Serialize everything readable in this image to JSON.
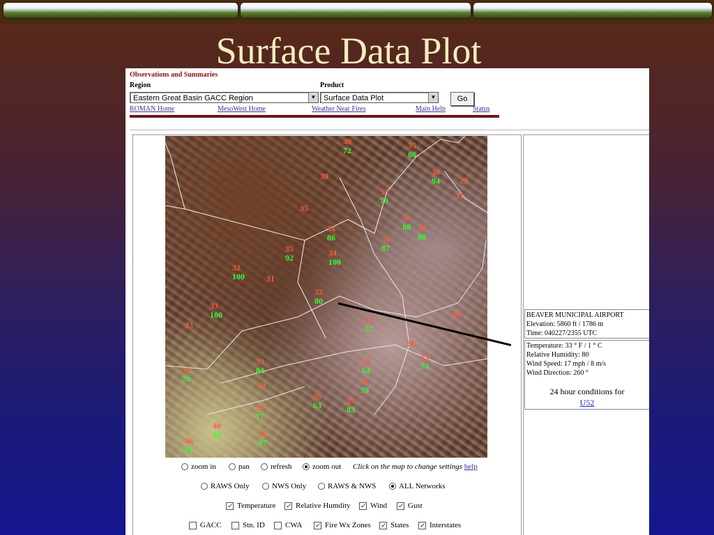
{
  "slide": {
    "title": "Surface Data Plot"
  },
  "header": {
    "title": "Observations and Summaries",
    "region_label": "Region",
    "product_label": "Product",
    "region_value": "Eastern Great Basin GACC Region",
    "product_value": "Surface Data Plot",
    "go_label": "Go"
  },
  "nav": {
    "links": [
      "ROMAN Home",
      "MesoWest Home",
      "Weather Near Fires",
      "Main Help",
      "Status"
    ]
  },
  "station": {
    "name": "BEAVER MUNICIPAL AIRPORT",
    "elevation": "Elevation: 5860 ft / 1786 m",
    "time": "Time: 040227/2355 UTC",
    "temperature": "Temperature: 33 ° F / 1 ° C",
    "humidity": "Relative Humidity: 80",
    "wind_speed": "Wind Speed: 17 mph / 8 m/s",
    "wind_direction": "Wind Direction: 260 °",
    "conditions_label": "24 hour conditions for",
    "conditions_link": "U52"
  },
  "map_observations": [
    {
      "t": "49",
      "h": "72"
    },
    {
      "t": "35",
      "h": "86"
    },
    {
      "t": "39",
      "h": ""
    },
    {
      "t": "38",
      "h": "94"
    },
    {
      "t": "29",
      "h": ""
    },
    {
      "t": "31",
      "h": ""
    },
    {
      "t": "35",
      "h": ""
    },
    {
      "t": "33",
      "h": "79"
    },
    {
      "t": "36",
      "h": "88"
    },
    {
      "t": "30",
      "h": "88"
    },
    {
      "t": "34",
      "h": "86"
    },
    {
      "t": "36",
      "h": "87"
    },
    {
      "t": "35",
      "h": "92"
    },
    {
      "t": "32",
      "h": "100"
    },
    {
      "t": "31",
      "h": ""
    },
    {
      "t": "34",
      "h": "100"
    },
    {
      "t": "33",
      "h": "100"
    },
    {
      "t": "32",
      "h": "80"
    },
    {
      "t": "33",
      "h": ""
    },
    {
      "t": "28",
      "h": ""
    },
    {
      "t": "31",
      "h": "57"
    },
    {
      "t": "28",
      "h": ""
    },
    {
      "t": "33",
      "h": "74"
    },
    {
      "t": "33",
      "h": "84"
    },
    {
      "t": "32",
      "h": "64"
    },
    {
      "t": "31",
      "h": "79"
    },
    {
      "t": "30",
      "h": ""
    },
    {
      "t": "37",
      "h": "77"
    },
    {
      "t": "40",
      "h": "50"
    },
    {
      "t": "37",
      "h": "97"
    },
    {
      "t": "46",
      "h": "91"
    },
    {
      "t": "31",
      "h": "74"
    },
    {
      "t": "29",
      "h": "83"
    },
    {
      "t": "26",
      "h": "63"
    }
  ],
  "controls": {
    "mode": [
      "zoom in",
      "pan",
      "refresh",
      "zoom out"
    ],
    "mode_selected": "zoom out",
    "hint": "Click on the map to change settings",
    "help": "help",
    "networks": [
      "RAWS Only",
      "NWS Only",
      "RAWS & NWS",
      "ALL Networks"
    ],
    "network_selected": "ALL Networks",
    "variables": [
      {
        "label": "Temperature",
        "checked": true
      },
      {
        "label": "Relative Humdity",
        "checked": true
      },
      {
        "label": "Wind",
        "checked": true
      },
      {
        "label": "Gust",
        "checked": true
      }
    ],
    "overlays": [
      {
        "label": "GACC",
        "checked": false
      },
      {
        "label": "Stn. ID",
        "checked": false
      },
      {
        "label": "CWA",
        "checked": false
      },
      {
        "label": "Fire Wx Zones",
        "checked": true
      },
      {
        "label": "States",
        "checked": true
      },
      {
        "label": "Interstates",
        "checked": true
      }
    ]
  }
}
